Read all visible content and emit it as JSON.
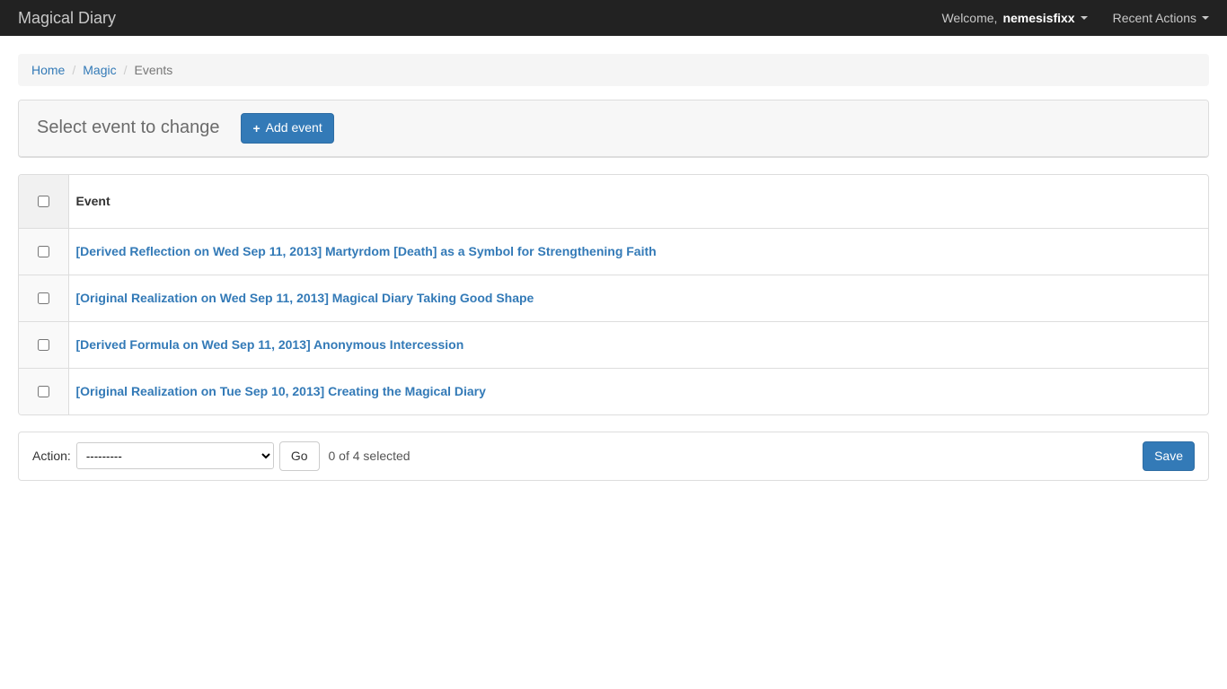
{
  "navbar": {
    "brand": "Magical Diary",
    "welcome_prefix": "Welcome, ",
    "username": "nemesisfixx",
    "recent_actions": "Recent Actions"
  },
  "breadcrumb": {
    "home": "Home",
    "magic": "Magic",
    "events": "Events"
  },
  "header": {
    "title": "Select event to change",
    "add_label": "Add event"
  },
  "table": {
    "event_header": "Event",
    "rows": [
      {
        "label": "[Derived Reflection on Wed Sep 11, 2013] Martyrdom [Death] as a Symbol for Strengthening Faith"
      },
      {
        "label": "[Original Realization on Wed Sep 11, 2013] Magical Diary Taking Good Shape"
      },
      {
        "label": "[Derived Formula on Wed Sep 11, 2013] Anonymous Intercession"
      },
      {
        "label": "[Original Realization on Tue Sep 10, 2013] Creating the Magical Diary"
      }
    ]
  },
  "actions": {
    "label": "Action:",
    "placeholder_option": "---------",
    "go_label": "Go",
    "selection_count": "0 of 4 selected",
    "save_label": "Save"
  }
}
